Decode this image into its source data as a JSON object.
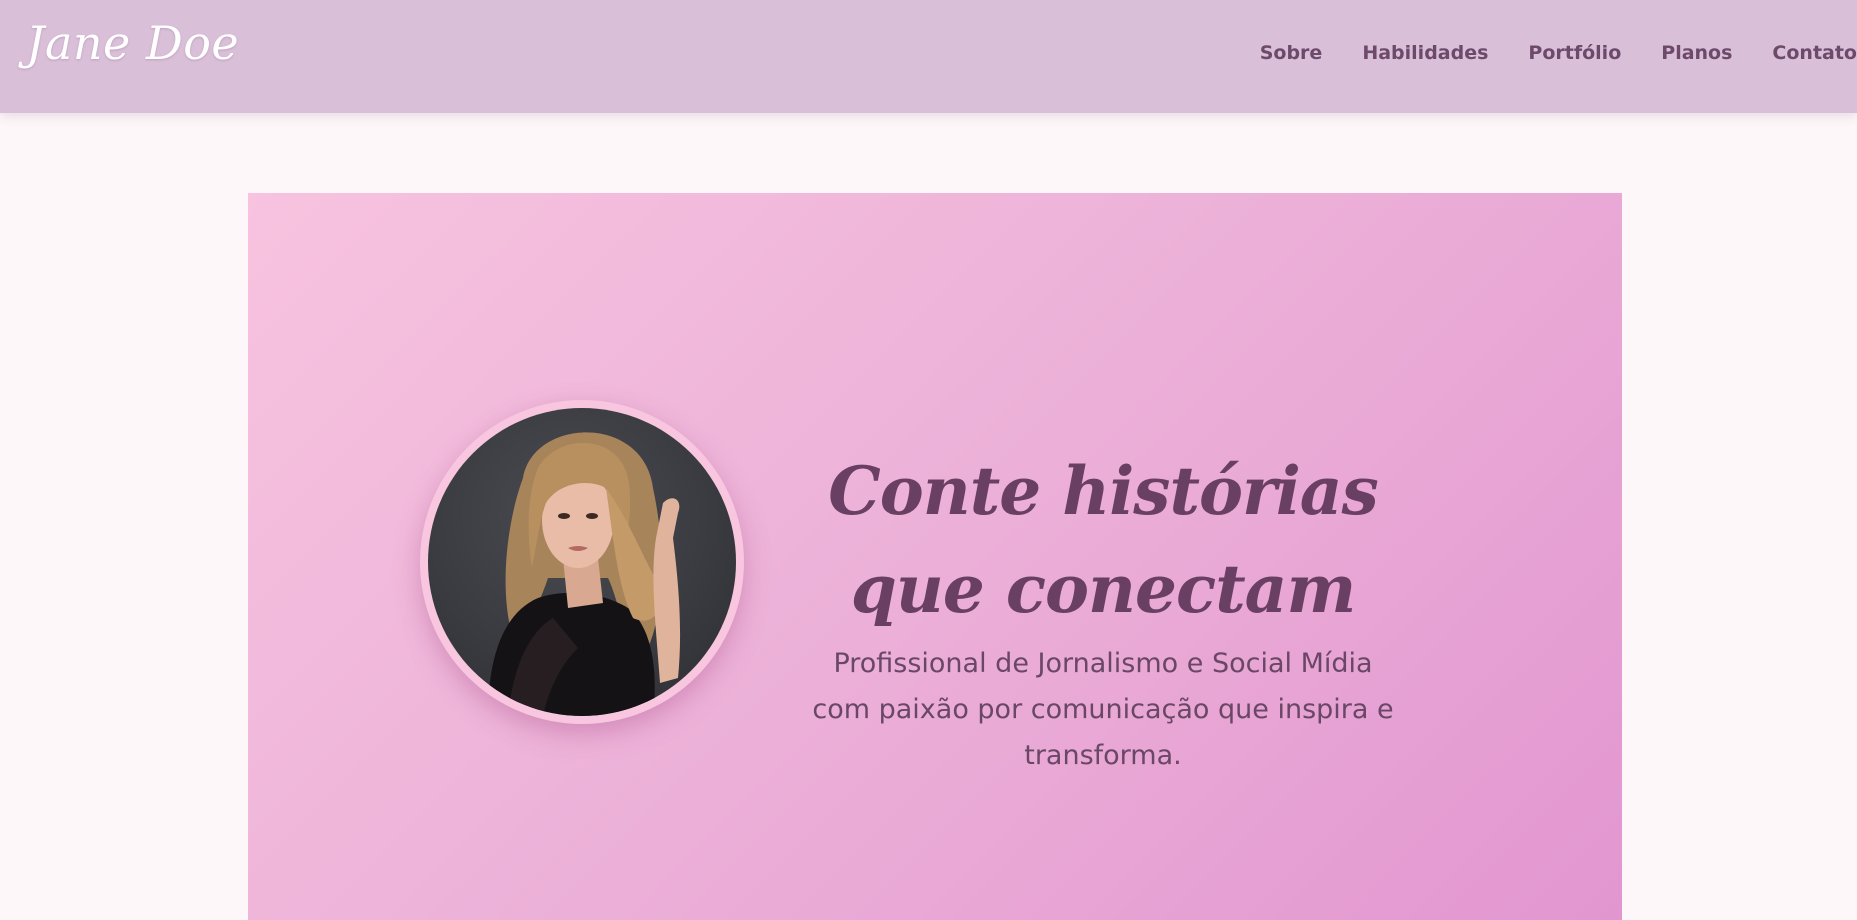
{
  "header": {
    "logo": "Jane Doe",
    "nav": [
      {
        "label": "Sobre"
      },
      {
        "label": "Habilidades"
      },
      {
        "label": "Portfólio"
      },
      {
        "label": "Planos"
      },
      {
        "label": "Contato"
      }
    ]
  },
  "hero": {
    "title": "Conte histórias que conectam",
    "subtitle": "Profissional de Jornalismo e Social Mídia com paixão por comunicação que inspira e transforma."
  },
  "colors": {
    "navbar": "#d9bfd8",
    "text_dark": "#6a3f64",
    "hero_gradient_start": "#f7c3df",
    "hero_gradient_end": "#e296d0",
    "page_background": "#fdf7f9"
  }
}
